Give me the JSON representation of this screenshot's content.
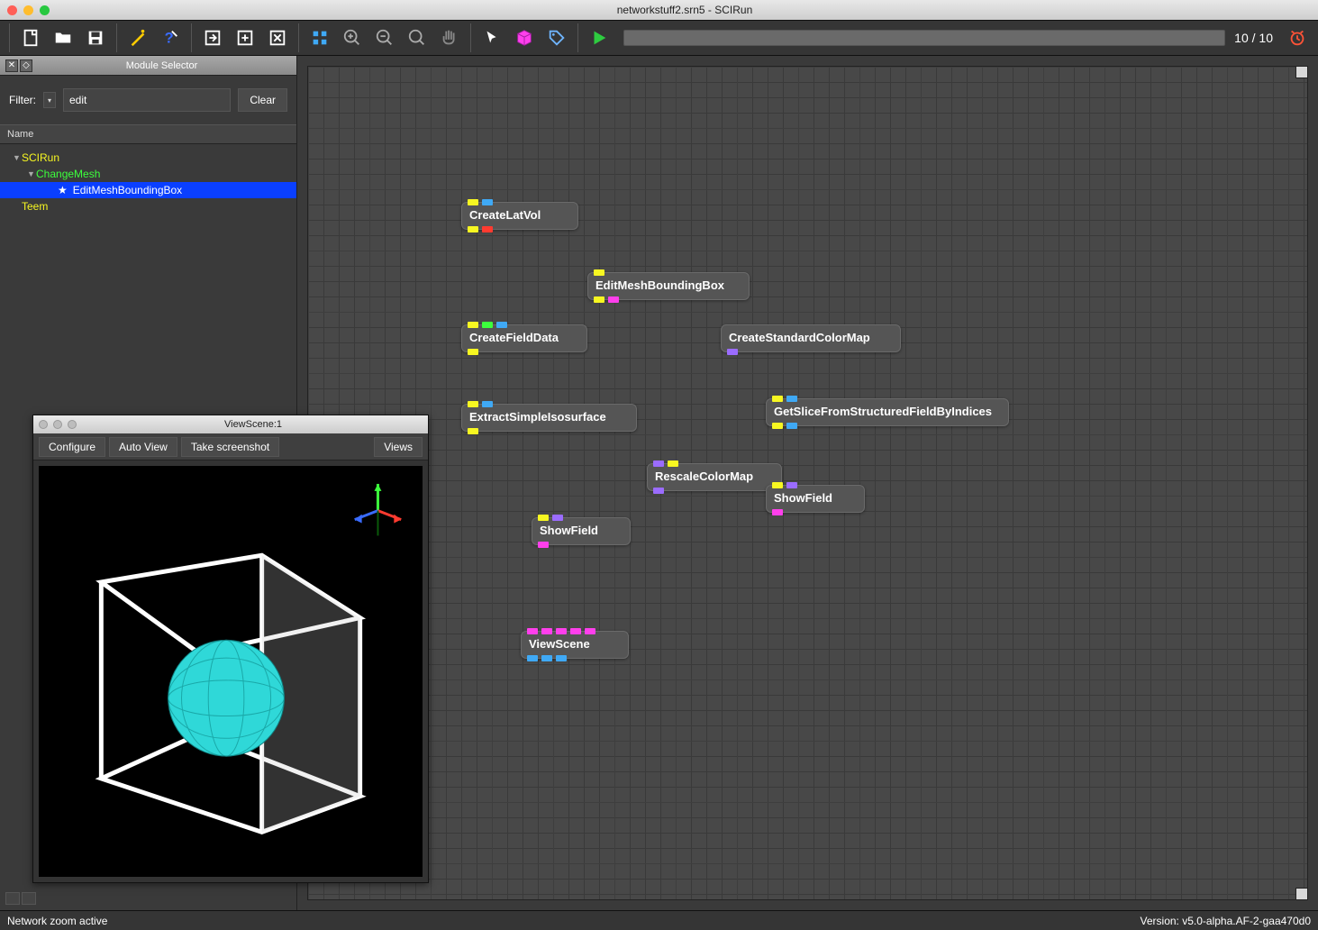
{
  "window": {
    "title": "networkstuff2.srn5 - SCIRun"
  },
  "toolbar": {
    "progress_text": "10 / 10"
  },
  "sidebar": {
    "panel_title": "Module Selector",
    "filter_label": "Filter:",
    "filter_value": "edit",
    "clear_label": "Clear",
    "tree_header": "Name",
    "tree": {
      "root": "SCIRun",
      "child": "ChangeMesh",
      "leaf": "EditMeshBoundingBox",
      "teem": "Teem"
    }
  },
  "nodes": {
    "n1": "CreateLatVol",
    "n2": "EditMeshBoundingBox",
    "n3": "CreateFieldData",
    "n4": "CreateStandardColorMap",
    "n5": "ExtractSimpleIsosurface",
    "n6": "GetSliceFromStructuredFieldByIndices",
    "n7": "RescaleColorMap",
    "n8": "ShowField",
    "n9": "ShowField",
    "n10": "ViewScene"
  },
  "viewscene": {
    "title": "ViewScene:1",
    "btn_configure": "Configure",
    "btn_autoview": "Auto View",
    "btn_screenshot": "Take screenshot",
    "btn_views": "Views"
  },
  "status": {
    "left": "Network zoom active",
    "right": "Version: v5.0-alpha.AF-2-gaa470d0"
  }
}
